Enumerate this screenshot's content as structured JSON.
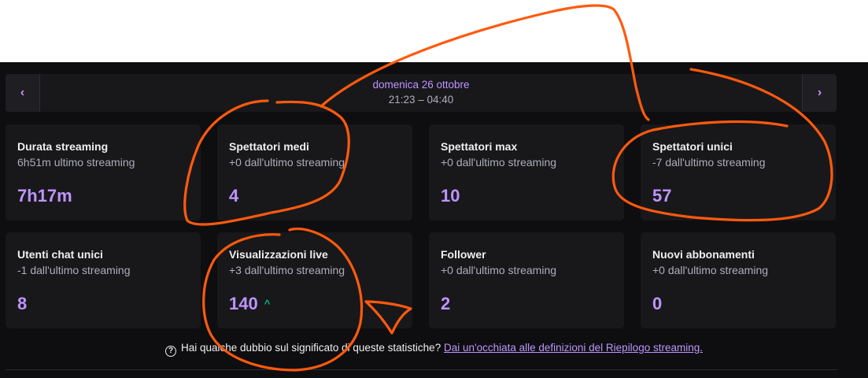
{
  "date_nav": {
    "prev_icon": "chevron-left-icon",
    "next_icon": "chevron-right-icon",
    "prev_glyph": "‹",
    "next_glyph": "›",
    "day": "domenica 26 ottobre",
    "time_range": "21:23 – 04:40"
  },
  "stats": [
    {
      "title": "Durata streaming",
      "sub": "6h51m ultimo streaming",
      "value": "7h17m"
    },
    {
      "title": "Spettatori medi",
      "sub": "+0 dall'ultimo streaming",
      "value": "4"
    },
    {
      "title": "Spettatori max",
      "sub": "+0 dall'ultimo streaming",
      "value": "10"
    },
    {
      "title": "Spettatori unici",
      "sub": "-7 dall'ultimo streaming",
      "value": "57"
    },
    {
      "title": "Utenti chat unici",
      "sub": "-1 dall'ultimo streaming",
      "value": "8"
    },
    {
      "title": "Visualizzazioni live",
      "sub": "+3 dall'ultimo streaming",
      "value": "140",
      "trend": "^"
    },
    {
      "title": "Follower",
      "sub": "+0 dall'ultimo streaming",
      "value": "2"
    },
    {
      "title": "Nuovi abbonamenti",
      "sub": "+0 dall'ultimo streaming",
      "value": "0"
    }
  ],
  "footer": {
    "help_icon": "question-circle-icon",
    "help_glyph": "?",
    "question": "Hai qualche dubbio sul significato di queste statistiche?",
    "link": "Dai un'occhiata alle definizioni del Riepilogo streaming."
  },
  "colors": {
    "accent": "#bf94ff",
    "background": "#0e0e10",
    "card": "#18181b",
    "trend_up": "#00c26f",
    "annotation": "#ff5a0e"
  }
}
